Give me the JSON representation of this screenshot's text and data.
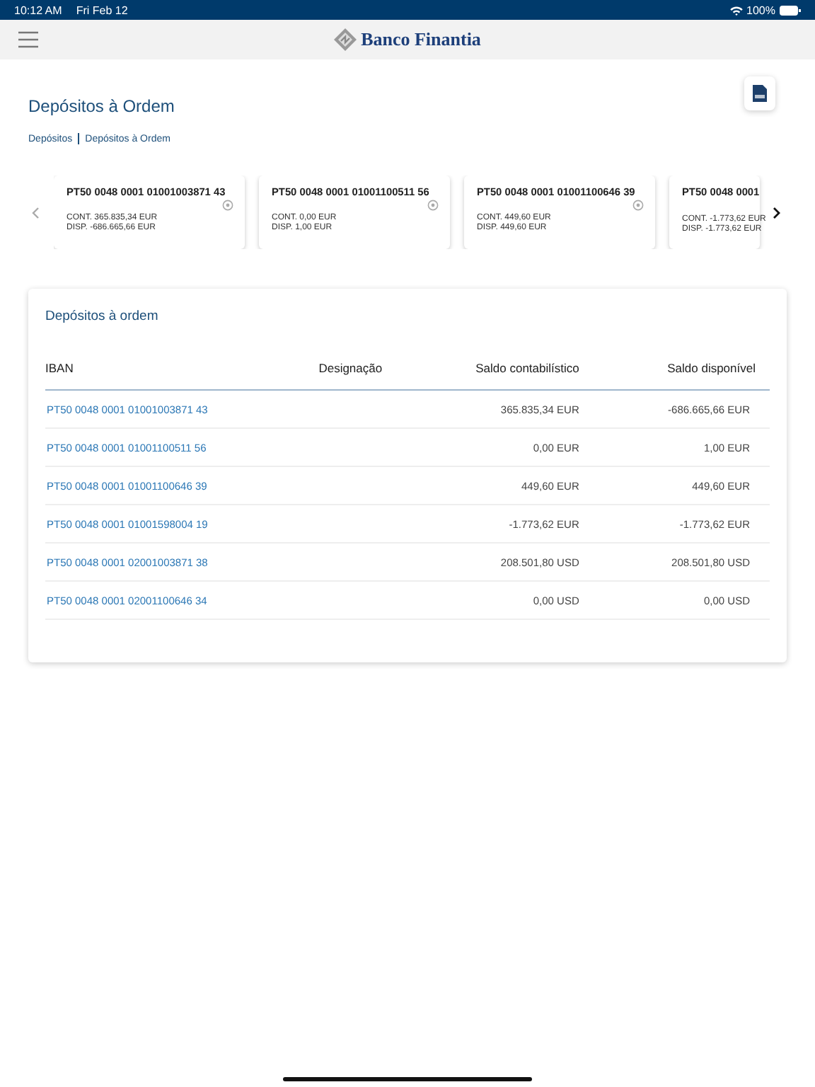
{
  "status_bar": {
    "time": "10:12 AM",
    "date": "Fri Feb 12",
    "battery": "100%"
  },
  "header": {
    "brand": "Banco Finantia"
  },
  "page": {
    "title": "Depósitos à Ordem",
    "breadcrumb": [
      "Depósitos",
      "Depósitos à Ordem"
    ]
  },
  "carousel": {
    "cards": [
      {
        "iban": "PT50 0048 0001 01001003871 43",
        "cont": "CONT. 365.835,34 EUR",
        "disp": "DISP. -686.665,66 EUR",
        "partial": false
      },
      {
        "iban": "PT50 0048 0001 01001100511 56",
        "cont": "CONT. 0,00 EUR",
        "disp": "DISP. 1,00 EUR",
        "partial": false
      },
      {
        "iban": "PT50 0048 0001 01001100646 39",
        "cont": "CONT. 449,60 EUR",
        "disp": "DISP. 449,60 EUR",
        "partial": false
      },
      {
        "iban": "PT50 0048 0001",
        "cont": "CONT. -1.773,62 EUR",
        "disp": "DISP. -1.773,62 EUR",
        "partial": true
      }
    ]
  },
  "table": {
    "title": "Depósitos à ordem",
    "columns": [
      "IBAN",
      "Designação",
      "Saldo contabilístico",
      "Saldo disponível"
    ],
    "rows": [
      {
        "iban": "PT50 0048 0001 01001003871 43",
        "saldo_contabilistico": "365.835,34 EUR",
        "saldo_disponivel": "-686.665,66 EUR"
      },
      {
        "iban": "PT50 0048 0001 01001100511 56",
        "saldo_contabilistico": "0,00 EUR",
        "saldo_disponivel": "1,00 EUR"
      },
      {
        "iban": "PT50 0048 0001 01001100646 39",
        "saldo_contabilistico": "449,60 EUR",
        "saldo_disponivel": "449,60 EUR"
      },
      {
        "iban": "PT50 0048 0001 01001598004 19",
        "saldo_contabilistico": "-1.773,62 EUR",
        "saldo_disponivel": "-1.773,62 EUR"
      },
      {
        "iban": "PT50 0048 0001 02001003871 38",
        "saldo_contabilistico": "208.501,80 USD",
        "saldo_disponivel": "208.501,80 USD"
      },
      {
        "iban": "PT50 0048 0001 02001100646 34",
        "saldo_contabilistico": "0,00 USD",
        "saldo_disponivel": "0,00 USD"
      }
    ]
  }
}
